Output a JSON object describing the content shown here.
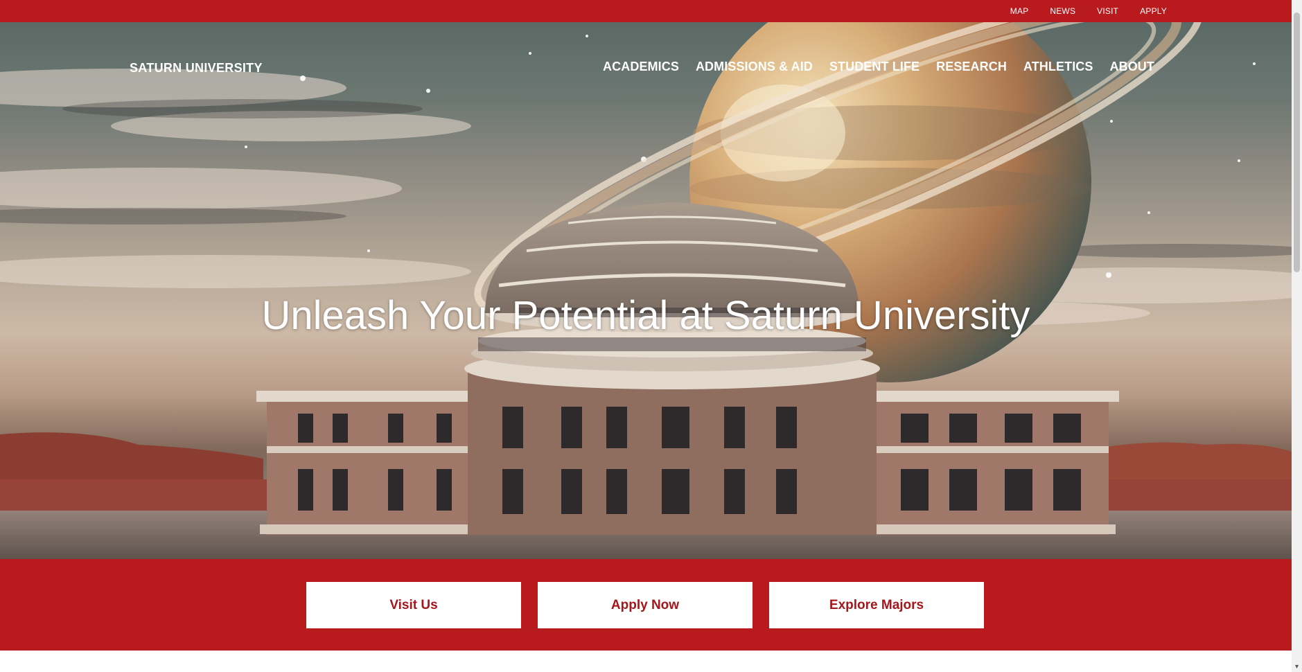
{
  "utility_nav": {
    "items": [
      {
        "label": "MAP"
      },
      {
        "label": "NEWS"
      },
      {
        "label": "VISIT"
      },
      {
        "label": "APPLY"
      }
    ]
  },
  "header": {
    "logo": "SATURN UNIVERSITY"
  },
  "main_nav": {
    "items": [
      {
        "label": "ACADEMICS"
      },
      {
        "label": "ADMISSIONS & AID"
      },
      {
        "label": "STUDENT LIFE"
      },
      {
        "label": "RESEARCH"
      },
      {
        "label": "ATHLETICS"
      },
      {
        "label": "ABOUT"
      }
    ]
  },
  "hero": {
    "title": "Unleash Your Potential at Saturn University"
  },
  "cta": {
    "buttons": [
      {
        "label": "Visit Us"
      },
      {
        "label": "Apply Now"
      },
      {
        "label": "Explore Majors"
      }
    ]
  },
  "colors": {
    "brand_red": "#b81a1e",
    "button_text": "#a4161a",
    "button_bg": "#ffffff"
  },
  "icons": {
    "scroll_down": "chevron-down-icon"
  }
}
